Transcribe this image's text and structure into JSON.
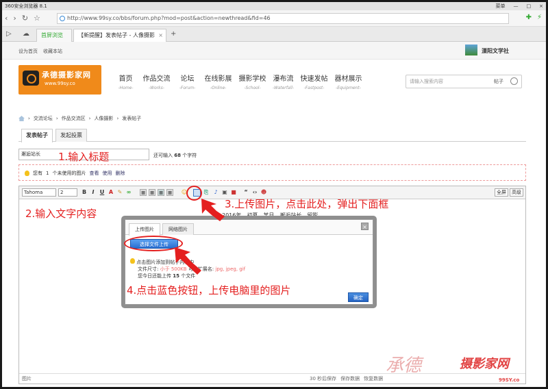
{
  "browser": {
    "title": "360安全浏览器 8.1",
    "title_right": [
      "菜单",
      "—",
      "□",
      "×"
    ],
    "url": "http://www.99sy.co/bbs/forum.php?mod=post&action=newthread&fid=46",
    "tabs": [
      {
        "label": "首屏浏览"
      },
      {
        "label": "【新提醒】发表帖子 - 人像摄影",
        "close": "×"
      }
    ],
    "new_tab": "+"
  },
  "topbar": {
    "links": [
      "设为首页",
      "收藏本站"
    ],
    "site": "溧阳文学社"
  },
  "logo": {
    "title": "承德摄影家网",
    "url": "www.99sy.co"
  },
  "nav": [
    {
      "zh": "首页",
      "en": "-Home-"
    },
    {
      "zh": "作品交流",
      "en": "-Works-"
    },
    {
      "zh": "论坛",
      "en": "-Forum-"
    },
    {
      "zh": "在线影展",
      "en": "-Online-"
    },
    {
      "zh": "摄影学校",
      "en": "-School-"
    },
    {
      "zh": "瀑布流",
      "en": "-Waterfall-"
    },
    {
      "zh": "快速发帖",
      "en": "-Fastpost-"
    },
    {
      "zh": "器材展示",
      "en": "-Equipment-"
    }
  ],
  "search": {
    "placeholder": "请输入搜索内容",
    "button": "帖子"
  },
  "breadcrumb": [
    "交流论坛",
    "作品交流区",
    "人像摄影",
    "发表帖子"
  ],
  "page_tabs": [
    "发表帖子",
    "发起投票"
  ],
  "form": {
    "title_value": "邂逅站长",
    "remain_pre": "还可输入",
    "remain_count": "68",
    "remain_post": "个字符"
  },
  "unused": {
    "pre": "您有",
    "count": "1",
    "post": "个未使用的图片",
    "view": "查看",
    "use": "使用",
    "delete": "删除"
  },
  "toolbar": {
    "font": "Tahoma",
    "size": "2",
    "fullscreen": "全屏",
    "advanced": "高级"
  },
  "editor": {
    "content": "2016年，初夏，某日，邂逅站长，留影。",
    "status_left": "图片",
    "status_right": [
      "30 秒后保存",
      "保存数据",
      "恢复数据"
    ]
  },
  "dialog": {
    "tabs": [
      "上传图片",
      "网络图片"
    ],
    "close": "×",
    "button": "选择文件上传",
    "info1": "点击图片添加到帖子内容中",
    "info2_pre": "文件尺寸:",
    "info2_size": "小于 500KB",
    "info2_mid": "可用扩展名:",
    "info2_ext": "jpg, jpeg, gif",
    "info3_pre": "您今日还能上传",
    "info3_count": "15",
    "info3_post": "个文件",
    "ok": "确定"
  },
  "annotations": {
    "a1": "1.输入标题",
    "a2": "2.输入文字内容",
    "a3": "3.上传图片，点击此处，弹出下面框",
    "a4": "4.点击蓝色按钮，上传电脑里的图片"
  },
  "watermark": {
    "w1": "承德",
    "w2": "摄影家网",
    "w3": "99SY.co"
  },
  "colors": {
    "annotation": "#e41f1f",
    "logo_bg": "#f08a1a",
    "button_blue": "#2a6fd1"
  }
}
